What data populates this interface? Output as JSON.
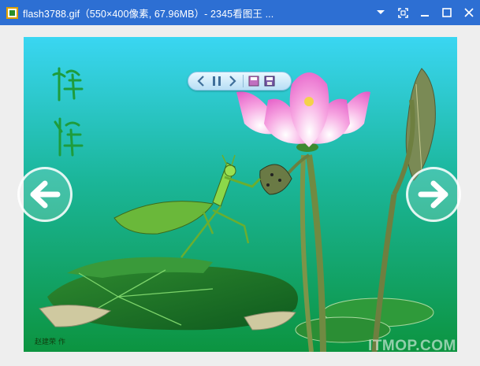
{
  "window": {
    "title": "flash3788.gif（550×400像素, 67.96MB）- 2345看图王 ...",
    "app_icon": "image-viewer-icon",
    "buttons": [
      "dropdown-icon",
      "fullscreen-icon",
      "minimize-icon",
      "maximize-icon",
      "close-icon"
    ]
  },
  "image": {
    "artist_signature": "赵建荣 作",
    "calligraphy": "螳螂",
    "colors": {
      "sky_top": "#38d8f0",
      "sky_bottom": "#0e9a55",
      "lotus": "#f080d0"
    }
  },
  "toolbar": {
    "buttons": [
      "prev-small-icon",
      "pause-icon",
      "next-small-icon",
      "save-icon",
      "save-as-icon"
    ]
  },
  "navigation": {
    "prev": "arrow-left-icon",
    "next": "arrow-right-icon"
  },
  "watermark": "ITMOP.COM"
}
